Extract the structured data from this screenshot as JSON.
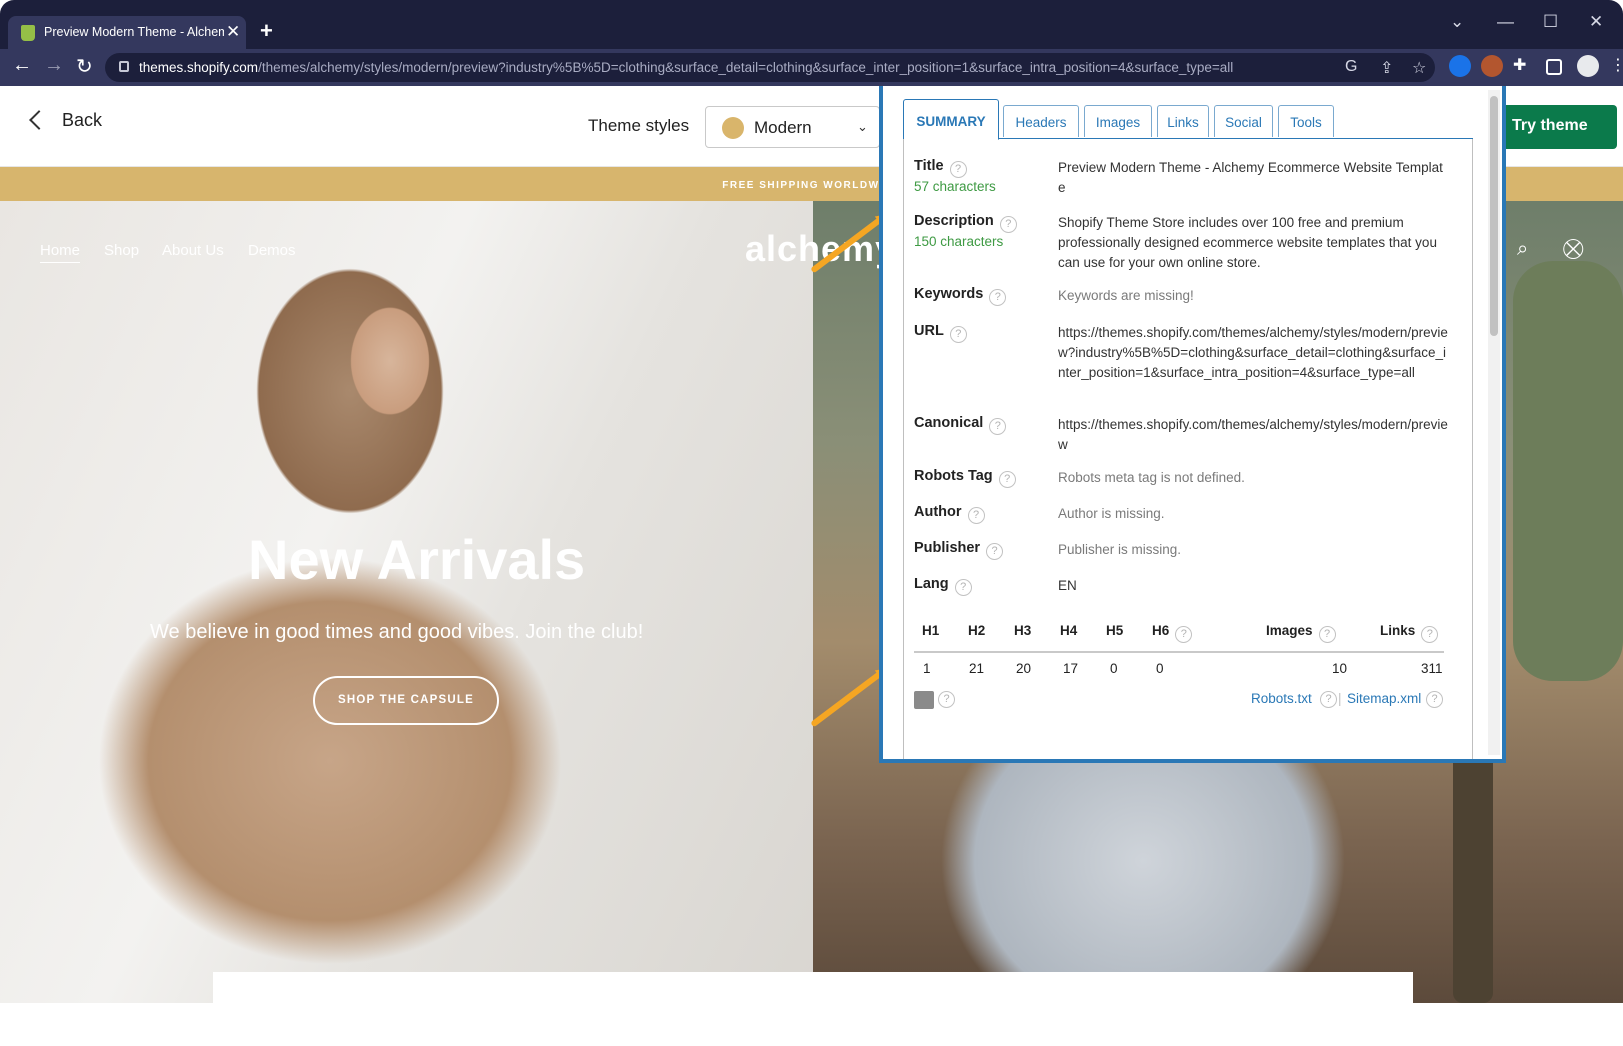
{
  "browser": {
    "tab_title": "Preview Modern Theme - Alchemy Ecommerce Website Template",
    "tab_close": "✕",
    "new_tab": "+",
    "url_host": "themes.shopify.com",
    "url_path": "/themes/alchemy/styles/modern/preview?industry%5B%5D=clothing&surface_detail=clothing&surface_inter_position=1&surface_intra_position=4&surface_type=all"
  },
  "page_header": {
    "back_label": "Back",
    "theme_styles_label": "Theme styles",
    "style_selected": "Modern",
    "try_theme_label": "Try theme"
  },
  "store": {
    "promo": "FREE SHIPPING WORLDWIDE",
    "nav": [
      "Home",
      "Shop",
      "About Us",
      "Demos"
    ],
    "logo": "alchemy",
    "hero_title": "New Arrivals",
    "hero_tagline": "We believe in good times and good vibes. Join the club!",
    "hero_button": "SHOP THE CAPSULE"
  },
  "seo": {
    "tabs": [
      "SUMMARY",
      "Headers",
      "Images",
      "Links",
      "Social",
      "Tools"
    ],
    "active_tab": "SUMMARY",
    "rows": {
      "title": {
        "label": "Title",
        "sub": "57 characters",
        "value": "Preview Modern Theme - Alchemy Ecommerce Website Template"
      },
      "description": {
        "label": "Description",
        "sub": "150 characters",
        "value": "Shopify Theme Store includes over 100 free and premium professionally designed ecommerce website templates that you can use for your own online store."
      },
      "keywords": {
        "label": "Keywords",
        "value": "Keywords are missing!"
      },
      "url": {
        "label": "URL",
        "value": "https://themes.shopify.com/themes/alchemy/styles/modern/preview?industry%5B%5D=clothing&surface_detail=clothing&surface_inter_position=1&surface_intra_position=4&surface_type=all"
      },
      "canonical": {
        "label": "Canonical",
        "value": "https://themes.shopify.com/themes/alchemy/styles/modern/preview"
      },
      "robots": {
        "label": "Robots Tag",
        "value": "Robots meta tag is not defined."
      },
      "author": {
        "label": "Author",
        "value": "Author is missing."
      },
      "publisher": {
        "label": "Publisher",
        "value": "Publisher is missing."
      },
      "lang": {
        "label": "Lang",
        "value": "EN"
      }
    },
    "headers_table": {
      "columns": [
        "H1",
        "H2",
        "H3",
        "H4",
        "H5",
        "H6",
        "Images",
        "Links"
      ],
      "values": [
        "1",
        "21",
        "20",
        "17",
        "0",
        "0",
        "10",
        "311"
      ]
    },
    "help_glyph": "?",
    "robots_link": "Robots.txt",
    "sitemap_link": "Sitemap.xml",
    "link_separator": "|"
  },
  "colors": {
    "chrome_dark": "#1c1f3b",
    "chrome_light": "#34385e",
    "promo_gold": "#d7b56d",
    "try_theme_green": "#0b7a4b",
    "seo_blue": "#2a78b6",
    "char_count_green": "#3e9a43",
    "annotation_arrow": "#f5a623"
  }
}
